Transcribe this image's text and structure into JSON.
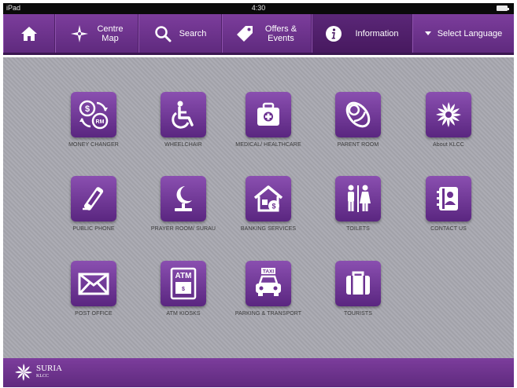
{
  "statusbar": {
    "carrier": "iPad",
    "time": "4:30"
  },
  "nav": {
    "home": "",
    "centre_map": "Centre Map",
    "search": "Search",
    "offers": "Offers & Events",
    "information": "Information",
    "language": "Select Language"
  },
  "colors": {
    "accent": "#6b3190",
    "background": "#a8a8b0"
  },
  "tiles": [
    {
      "label": "MONEY CHANGER",
      "icon": "money-changer-icon"
    },
    {
      "label": "WHEELCHAIR",
      "icon": "wheelchair-icon"
    },
    {
      "label": "MEDICAL/ HEALTHCARE",
      "icon": "medical-kit-icon"
    },
    {
      "label": "PARENT ROOM",
      "icon": "baby-icon"
    },
    {
      "label": "About KLCC",
      "icon": "klcc-logo-icon"
    },
    {
      "label": "PUBLIC PHONE",
      "icon": "phone-icon"
    },
    {
      "label": "PRAYER ROOM/ SURAU",
      "icon": "crescent-icon"
    },
    {
      "label": "BANKING SERVICES",
      "icon": "bank-icon"
    },
    {
      "label": "TOILETS",
      "icon": "toilets-icon"
    },
    {
      "label": "CONTACT US",
      "icon": "contact-book-icon"
    },
    {
      "label": "POST OFFICE",
      "icon": "envelope-icon"
    },
    {
      "label": "ATM KIOSKS",
      "icon": "atm-icon"
    },
    {
      "label": "PARKING & TRANSPORT",
      "icon": "taxi-icon"
    },
    {
      "label": "TOURISTS",
      "icon": "suitcase-icon"
    }
  ],
  "icon_text": {
    "atm": "ATM",
    "taxi": "TAXI"
  },
  "footer": {
    "brand": "SURIA",
    "sub": "KLCC"
  }
}
